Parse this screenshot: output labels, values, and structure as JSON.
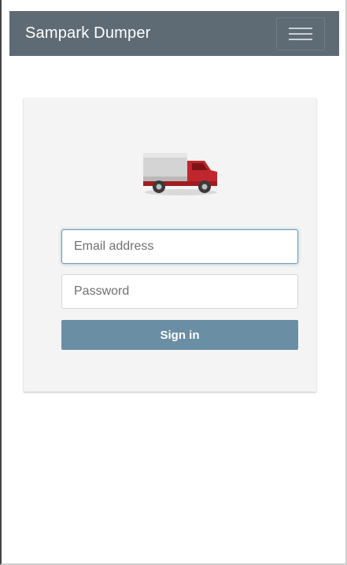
{
  "navbar": {
    "brand": "Sampark Dumper",
    "menu_icon": "hamburger-menu-icon"
  },
  "login": {
    "logo_icon": "truck-icon",
    "email_placeholder": "Email address",
    "email_value": "",
    "password_placeholder": "Password",
    "password_value": "",
    "submit_label": "Sign in"
  },
  "colors": {
    "navbar_bg": "#5f6b74",
    "card_bg": "#f4f4f4",
    "button_bg": "#6a8ea4",
    "input_focus": "#6a9cb5",
    "truck_cab": "#c0262b",
    "truck_box": "#cfcfcf"
  }
}
